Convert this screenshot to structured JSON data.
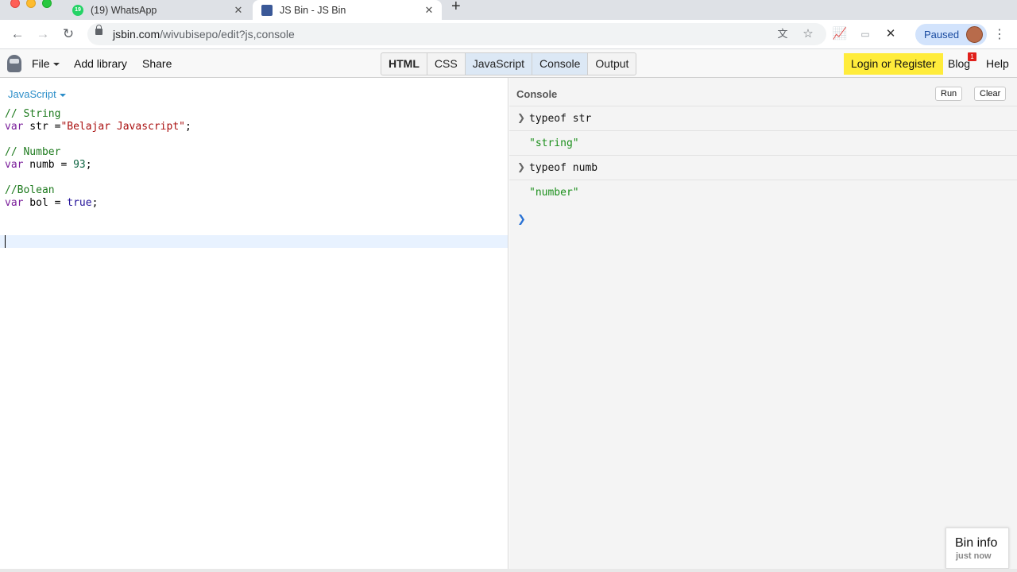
{
  "browser": {
    "tabs": [
      {
        "title": "(19) WhatsApp",
        "badge": "19",
        "active": false
      },
      {
        "title": "JS Bin - JS Bin",
        "active": true
      }
    ],
    "new_tab": "+",
    "url_host": "jsbin.com",
    "url_rest": "/wivubisepo/edit?js,console",
    "profile_status": "Paused",
    "colors": {
      "accent": "#1a4ba0",
      "paused_bg": "#d2e3fc"
    }
  },
  "jsbin": {
    "menu": {
      "file": "File",
      "add_library": "Add library",
      "share": "Share"
    },
    "panels": [
      {
        "label": "HTML",
        "active": false
      },
      {
        "label": "CSS",
        "active": false
      },
      {
        "label": "JavaScript",
        "active": true
      },
      {
        "label": "Console",
        "active": true
      },
      {
        "label": "Output",
        "active": false
      }
    ],
    "login": "Login or Register",
    "blog": "Blog",
    "blog_badge": "1",
    "help": "Help",
    "colors": {
      "login_bg": "#ffec3b",
      "active_panel": "#dce8f5"
    }
  },
  "editor": {
    "language": "JavaScript",
    "code": {
      "l1": "// String",
      "l2_kw": "var",
      "l2_name": " str =",
      "l2_str": "\"Belajar Javascript\"",
      "l2_end": ";",
      "l4": "// Number",
      "l5_kw": "var",
      "l5_name": " numb = ",
      "l5_num": "93",
      "l5_end": ";",
      "l7": "//Bolean",
      "l8_kw": "var",
      "l8_name": " bol = ",
      "l8_atom": "true",
      "l8_end": ";"
    }
  },
  "console": {
    "title": "Console",
    "run": "Run",
    "clear": "Clear",
    "entries": [
      {
        "input": "typeof str",
        "output": "\"string\""
      },
      {
        "input": "typeof numb",
        "output": "\"number\""
      }
    ]
  },
  "bin_info": {
    "title": "Bin info",
    "time": "just now"
  }
}
